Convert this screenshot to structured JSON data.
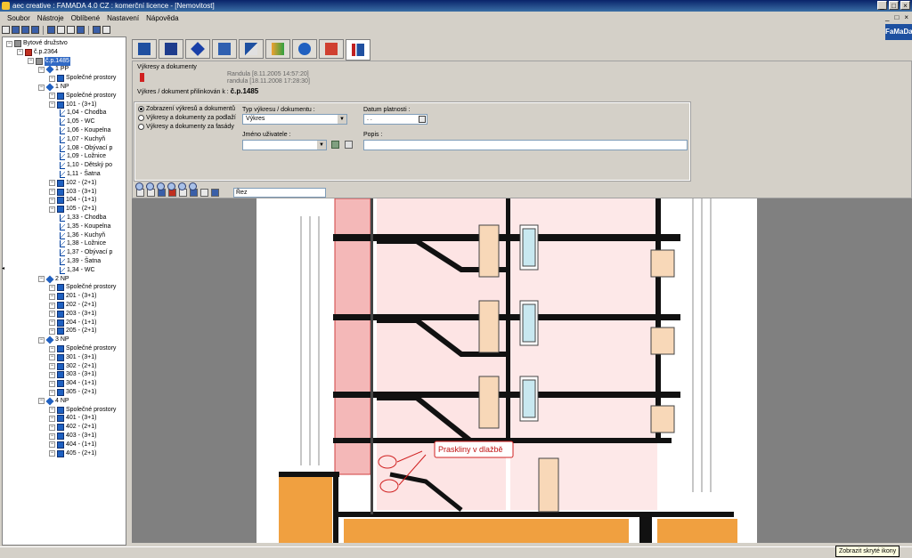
{
  "window": {
    "title": "aec creative : FAMADA 4.0 CZ : komerční licence - [Nemovitost]",
    "min": "_",
    "max": "□",
    "close": "×"
  },
  "menu": [
    "Soubor",
    "Nástroje",
    "Oblíbené",
    "Nastavení",
    "Nápověda"
  ],
  "brand": "FaMaDa",
  "tree": [
    {
      "level": 0,
      "label": "Bytové družstvo",
      "icon": "building"
    },
    {
      "level": 1,
      "label": "č.p.2364",
      "icon": "red"
    },
    {
      "level": 2,
      "label": "č.p.1485",
      "icon": "building",
      "selected": true
    },
    {
      "level": 3,
      "label": "1 PP",
      "icon": "floor"
    },
    {
      "level": 4,
      "label": "Společné prostory",
      "icon": "blue"
    },
    {
      "level": 3,
      "label": "1 NP",
      "icon": "floor"
    },
    {
      "level": 4,
      "label": "Společné prostory",
      "icon": "blue"
    },
    {
      "level": 4,
      "label": "101 - (3+1)",
      "icon": "blue"
    },
    {
      "level": 5,
      "label": "1,04 - Chodba",
      "icon": "room"
    },
    {
      "level": 5,
      "label": "1,05 - WC",
      "icon": "room"
    },
    {
      "level": 5,
      "label": "1,06 - Koupelna",
      "icon": "room"
    },
    {
      "level": 5,
      "label": "1,07 - Kuchyň",
      "icon": "room"
    },
    {
      "level": 5,
      "label": "1,08 - Obývací p",
      "icon": "room"
    },
    {
      "level": 5,
      "label": "1,09 - Ložnice",
      "icon": "room"
    },
    {
      "level": 5,
      "label": "1,10 - Dětský po",
      "icon": "room"
    },
    {
      "level": 5,
      "label": "1,11 - Šatna",
      "icon": "room"
    },
    {
      "level": 4,
      "label": "102 - (2+1)",
      "icon": "blue"
    },
    {
      "level": 4,
      "label": "103 - (3+1)",
      "icon": "blue"
    },
    {
      "level": 4,
      "label": "104 - (1+1)",
      "icon": "blue"
    },
    {
      "level": 4,
      "label": "105 - (2+1)",
      "icon": "blue"
    },
    {
      "level": 5,
      "label": "1,33 - Chodba",
      "icon": "room"
    },
    {
      "level": 5,
      "label": "1,35 - Koupelna",
      "icon": "room"
    },
    {
      "level": 5,
      "label": "1,36 - Kuchyň",
      "icon": "room"
    },
    {
      "level": 5,
      "label": "1,38 - Ložnice",
      "icon": "room"
    },
    {
      "level": 5,
      "label": "1,37 - Obývací p",
      "icon": "room"
    },
    {
      "level": 5,
      "label": "1,39 - Šatna",
      "icon": "room"
    },
    {
      "level": 5,
      "label": "1,34 - WC",
      "icon": "room"
    },
    {
      "level": 3,
      "label": "2 NP",
      "icon": "floor"
    },
    {
      "level": 4,
      "label": "Společné prostory",
      "icon": "blue"
    },
    {
      "level": 4,
      "label": "201 - (3+1)",
      "icon": "blue"
    },
    {
      "level": 4,
      "label": "202 - (2+1)",
      "icon": "blue"
    },
    {
      "level": 4,
      "label": "203 - (3+1)",
      "icon": "blue"
    },
    {
      "level": 4,
      "label": "204 - (1+1)",
      "icon": "blue"
    },
    {
      "level": 4,
      "label": "205 - (2+1)",
      "icon": "blue"
    },
    {
      "level": 3,
      "label": "3 NP",
      "icon": "floor"
    },
    {
      "level": 4,
      "label": "Společné prostory",
      "icon": "blue"
    },
    {
      "level": 4,
      "label": "301 - (3+1)",
      "icon": "blue"
    },
    {
      "level": 4,
      "label": "302 - (2+1)",
      "icon": "blue"
    },
    {
      "level": 4,
      "label": "303 - (3+1)",
      "icon": "blue"
    },
    {
      "level": 4,
      "label": "304 - (1+1)",
      "icon": "blue"
    },
    {
      "level": 4,
      "label": "305 - (2+1)",
      "icon": "blue"
    },
    {
      "level": 3,
      "label": "4 NP",
      "icon": "floor"
    },
    {
      "level": 4,
      "label": "Společné prostory",
      "icon": "blue"
    },
    {
      "level": 4,
      "label": "401 - (3+1)",
      "icon": "blue"
    },
    {
      "level": 4,
      "label": "402 - (2+1)",
      "icon": "blue"
    },
    {
      "level": 4,
      "label": "403 - (3+1)",
      "icon": "blue"
    },
    {
      "level": 4,
      "label": "404 - (1+1)",
      "icon": "blue"
    },
    {
      "level": 4,
      "label": "405 - (2+1)",
      "icon": "blue"
    }
  ],
  "panel": {
    "caption": "Výkresy a dokumenty",
    "info_1": "Randula [8.11.2005 14:57:20]",
    "info_2": "randula [18.11.2008 17:28:30]",
    "link_label": "Výkres / dokument přilinkován k :",
    "link_value": "č.p.1485",
    "radios": [
      "Zobrazení výkresů a dokumentů",
      "Výkresy a dokumenty za podlaží",
      "Výkresy a dokumenty za fasády"
    ],
    "type_label": "Typ výkresu / dokumentu :",
    "type_value": "Výkres",
    "date_label": "Datum platnosti :",
    "date_value": " . .",
    "user_label": "Jméno uživatele :",
    "user_value": "",
    "desc_label": "Popis :",
    "desc_value": "",
    "drawing_name": "Řez"
  },
  "drawing": {
    "annotation": "Praskliny v dlažbě"
  },
  "tooltip": "Zobrazit skryté ikony"
}
